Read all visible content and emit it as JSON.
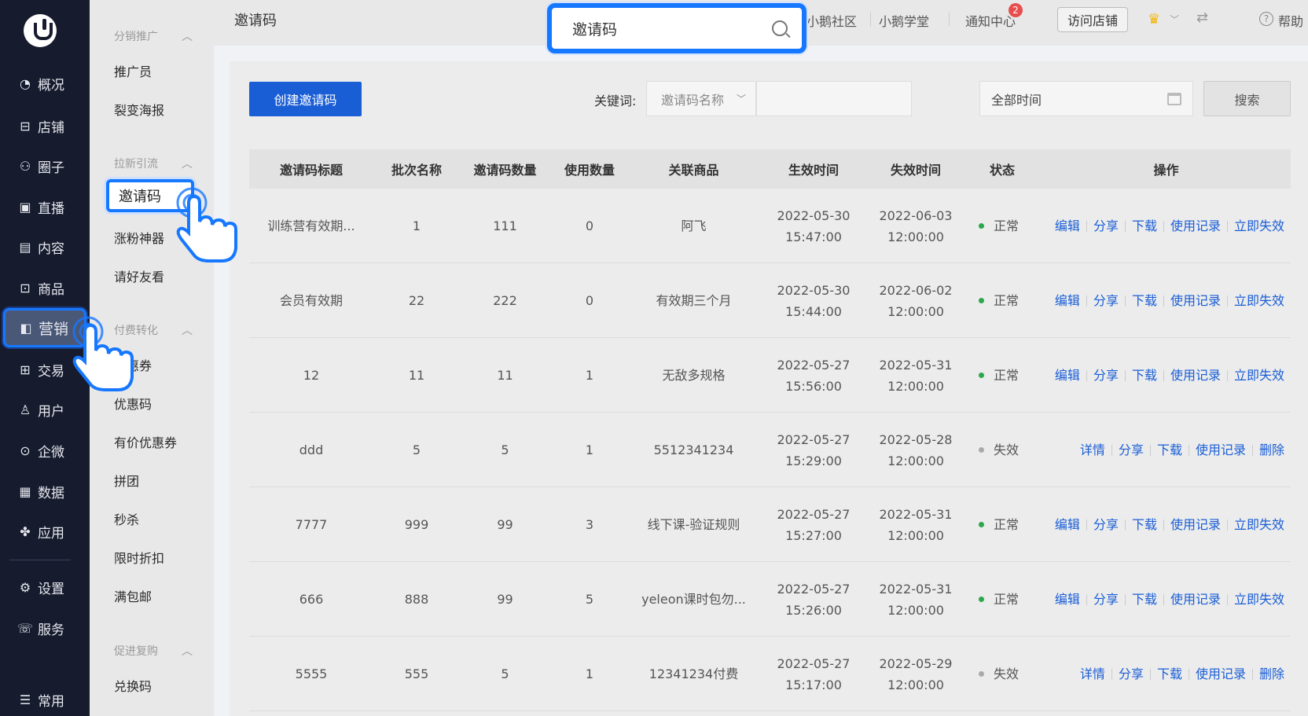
{
  "nav": {
    "items": [
      {
        "icon": "◔",
        "label": "概况"
      },
      {
        "icon": "⊟",
        "label": "店铺"
      },
      {
        "icon": "⚇",
        "label": "圈子"
      },
      {
        "icon": "▣",
        "label": "直播"
      },
      {
        "icon": "▤",
        "label": "内容"
      },
      {
        "icon": "⊡",
        "label": "商品"
      },
      {
        "icon": "◧",
        "label": "营销"
      },
      {
        "icon": "⊞",
        "label": "交易"
      },
      {
        "icon": "♙",
        "label": "用户"
      },
      {
        "icon": "⊙",
        "label": "企微"
      },
      {
        "icon": "▦",
        "label": "数据"
      },
      {
        "icon": "✤",
        "label": "应用"
      },
      {
        "icon": "⚙",
        "label": "设置"
      },
      {
        "icon": "☏",
        "label": "服务"
      },
      {
        "icon": "☰",
        "label": "常用"
      }
    ]
  },
  "subnav": {
    "groups": [
      "分销推广",
      "拉新引流",
      "付费转化",
      "促进复购"
    ],
    "items": [
      "推广员",
      "裂变海报",
      "邀请码",
      "涨粉神器",
      "请好友看",
      "优惠券",
      "优惠码",
      "有价优惠券",
      "拼团",
      "秒杀",
      "限时折扣",
      "满包邮",
      "兑换码"
    ]
  },
  "topbar": {
    "page_title": "邀请码",
    "search_value": "邀请码",
    "links": [
      "小鹅社区",
      "小鹅学堂",
      "通知中心"
    ],
    "notify_badge": "2",
    "visit_store": "访问店铺",
    "help": "帮助"
  },
  "toolbar": {
    "create_btn": "创建邀请码",
    "keyword_label": "关键词:",
    "keyword_select": "邀请码名称",
    "time_select": "全部时间",
    "search_btn": "搜索"
  },
  "table": {
    "headers": [
      "邀请码标题",
      "批次名称",
      "邀请码数量",
      "使用数量",
      "关联商品",
      "生效时间",
      "失效时间",
      "状态",
      "操作"
    ],
    "rows": [
      {
        "title": "训练营有效期...",
        "batch": "1",
        "count": "111",
        "used": "0",
        "product": "阿飞",
        "start_date": "2022-05-30",
        "start_time": "15:47:00",
        "end_date": "2022-06-03",
        "end_time": "12:00:00",
        "status": "正常",
        "status_color": "#2aa84a",
        "ops": [
          "编辑",
          "分享",
          "下载",
          "使用记录",
          "立即失效"
        ]
      },
      {
        "title": "会员有效期",
        "batch": "22",
        "count": "222",
        "used": "0",
        "product": "有效期三个月",
        "start_date": "2022-05-30",
        "start_time": "15:44:00",
        "end_date": "2022-06-02",
        "end_time": "12:00:00",
        "status": "正常",
        "status_color": "#2aa84a",
        "ops": [
          "编辑",
          "分享",
          "下载",
          "使用记录",
          "立即失效"
        ]
      },
      {
        "title": "12",
        "batch": "11",
        "count": "11",
        "used": "1",
        "product": "无敌多规格",
        "start_date": "2022-05-27",
        "start_time": "15:56:00",
        "end_date": "2022-05-31",
        "end_time": "12:00:00",
        "status": "正常",
        "status_color": "#2aa84a",
        "ops": [
          "编辑",
          "分享",
          "下载",
          "使用记录",
          "立即失效"
        ]
      },
      {
        "title": "ddd",
        "batch": "5",
        "count": "5",
        "used": "1",
        "product": "5512341234",
        "start_date": "2022-05-27",
        "start_time": "15:29:00",
        "end_date": "2022-05-28",
        "end_time": "12:00:00",
        "status": "失效",
        "status_color": "#aaaaaa",
        "ops": [
          "详情",
          "分享",
          "下载",
          "使用记录",
          "删除"
        ]
      },
      {
        "title": "7777",
        "batch": "999",
        "count": "99",
        "used": "3",
        "product": "线下课-验证规则",
        "start_date": "2022-05-27",
        "start_time": "15:27:00",
        "end_date": "2022-05-31",
        "end_time": "12:00:00",
        "status": "正常",
        "status_color": "#2aa84a",
        "ops": [
          "编辑",
          "分享",
          "下载",
          "使用记录",
          "立即失效"
        ]
      },
      {
        "title": "666",
        "batch": "888",
        "count": "99",
        "used": "5",
        "product": "yeleon课时包勿...",
        "start_date": "2022-05-27",
        "start_time": "15:26:00",
        "end_date": "2022-05-31",
        "end_time": "12:00:00",
        "status": "正常",
        "status_color": "#2aa84a",
        "ops": [
          "编辑",
          "分享",
          "下载",
          "使用记录",
          "立即失效"
        ]
      },
      {
        "title": "5555",
        "batch": "555",
        "count": "5",
        "used": "1",
        "product": "12341234付费",
        "start_date": "2022-05-27",
        "start_time": "15:17:00",
        "end_date": "2022-05-29",
        "end_time": "12:00:00",
        "status": "失效",
        "status_color": "#aaaaaa",
        "ops": [
          "详情",
          "分享",
          "下载",
          "使用记录",
          "删除"
        ]
      }
    ]
  }
}
